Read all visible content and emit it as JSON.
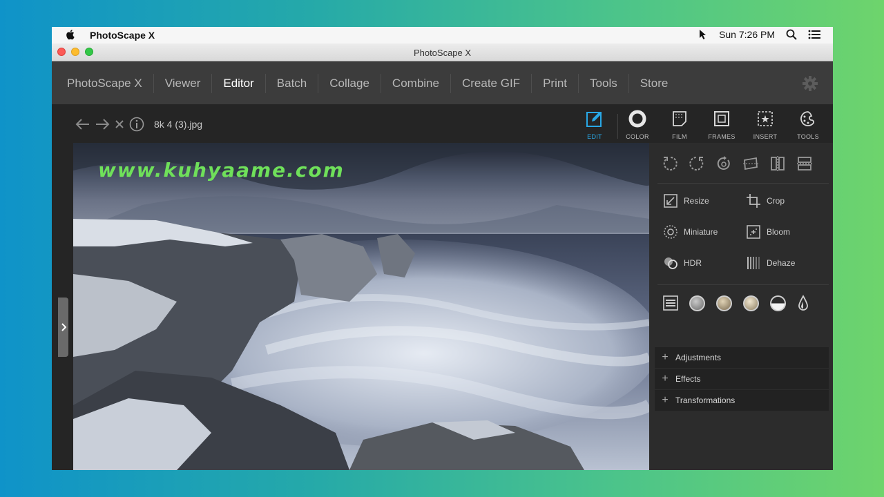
{
  "menubar": {
    "app_name": "PhotoScape X",
    "clock": "Sun 7:26 PM",
    "icons": [
      "cursor-icon",
      "search-icon",
      "list-icon"
    ]
  },
  "window": {
    "title": "PhotoScape X"
  },
  "nav": {
    "items": [
      "PhotoScape X",
      "Viewer",
      "Editor",
      "Batch",
      "Collage",
      "Combine",
      "Create GIF",
      "Print",
      "Tools",
      "Store"
    ],
    "active": "Editor"
  },
  "toolbar": {
    "filename": "8k 4 (3).jpg",
    "tools": [
      {
        "label": "EDIT",
        "icon": "edit-icon",
        "active": true
      },
      {
        "label": "COLOR",
        "icon": "color-icon"
      },
      {
        "label": "FILM",
        "icon": "film-icon"
      },
      {
        "label": "FRAMES",
        "icon": "frames-icon"
      },
      {
        "label": "INSERT",
        "icon": "insert-icon"
      },
      {
        "label": "TOOLS",
        "icon": "tools-icon"
      }
    ]
  },
  "photo": {
    "watermark": "www.kuhyaame.com"
  },
  "panel": {
    "features": [
      {
        "label": "Resize",
        "icon": "resize-icon"
      },
      {
        "label": "Crop",
        "icon": "crop-icon"
      },
      {
        "label": "Miniature",
        "icon": "miniature-icon"
      },
      {
        "label": "Bloom",
        "icon": "bloom-icon"
      },
      {
        "label": "HDR",
        "icon": "hdr-icon"
      },
      {
        "label": "Dehaze",
        "icon": "dehaze-icon"
      }
    ],
    "sections": [
      "Adjustments",
      "Effects",
      "Transformations"
    ]
  },
  "colors": {
    "accent": "#29a8e6",
    "watermark": "#6fe05a"
  }
}
